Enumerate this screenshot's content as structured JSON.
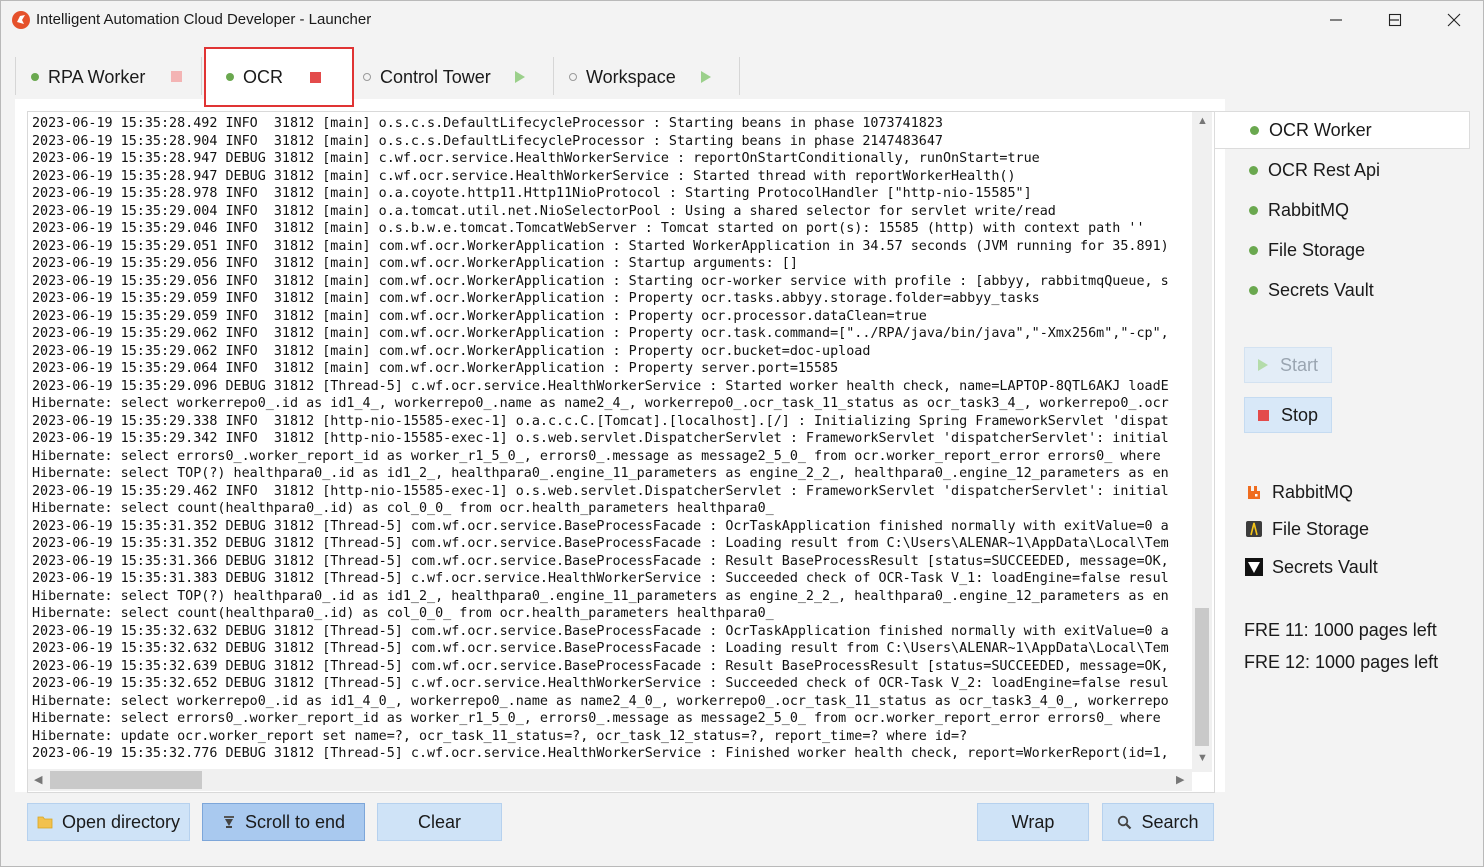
{
  "window": {
    "title": "Intelligent Automation Cloud Developer - Launcher",
    "minimize_icon": "minimize-icon",
    "maximize_icon": "maximize-icon",
    "close_icon": "close-icon"
  },
  "tabs": [
    {
      "label": "RPA Worker",
      "status": "running",
      "control": "stop"
    },
    {
      "label": "OCR",
      "status": "running",
      "control": "stop",
      "selected": true
    },
    {
      "label": "Control Tower",
      "status": "stopped",
      "control": "play"
    },
    {
      "label": "Workspace",
      "status": "stopped",
      "control": "play"
    }
  ],
  "log": {
    "lines": [
      "2023-06-19 15:35:28.492 INFO  31812 [main] o.s.c.s.DefaultLifecycleProcessor : Starting beans in phase 1073741823",
      "2023-06-19 15:35:28.904 INFO  31812 [main] o.s.c.s.DefaultLifecycleProcessor : Starting beans in phase 2147483647",
      "2023-06-19 15:35:28.947 DEBUG 31812 [main] c.wf.ocr.service.HealthWorkerService : reportOnStartConditionally, runOnStart=true",
      "2023-06-19 15:35:28.947 DEBUG 31812 [main] c.wf.ocr.service.HealthWorkerService : Started thread with reportWorkerHealth()",
      "2023-06-19 15:35:28.978 INFO  31812 [main] o.a.coyote.http11.Http11NioProtocol : Starting ProtocolHandler [\"http-nio-15585\"]",
      "2023-06-19 15:35:29.004 INFO  31812 [main] o.a.tomcat.util.net.NioSelectorPool : Using a shared selector for servlet write/read",
      "2023-06-19 15:35:29.046 INFO  31812 [main] o.s.b.w.e.tomcat.TomcatWebServer : Tomcat started on port(s): 15585 (http) with context path ''",
      "2023-06-19 15:35:29.051 INFO  31812 [main] com.wf.ocr.WorkerApplication : Started WorkerApplication in 34.57 seconds (JVM running for 35.891)",
      "2023-06-19 15:35:29.056 INFO  31812 [main] com.wf.ocr.WorkerApplication : Startup arguments: []",
      "2023-06-19 15:35:29.056 INFO  31812 [main] com.wf.ocr.WorkerApplication : Starting ocr-worker service with profile : [abbyy, rabbitmqQueue, s",
      "2023-06-19 15:35:29.059 INFO  31812 [main] com.wf.ocr.WorkerApplication : Property ocr.tasks.abbyy.storage.folder=abbyy_tasks",
      "2023-06-19 15:35:29.059 INFO  31812 [main] com.wf.ocr.WorkerApplication : Property ocr.processor.dataClean=true",
      "2023-06-19 15:35:29.062 INFO  31812 [main] com.wf.ocr.WorkerApplication : Property ocr.task.command=[\"../RPA/java/bin/java\",\"-Xmx256m\",\"-cp\",",
      "2023-06-19 15:35:29.062 INFO  31812 [main] com.wf.ocr.WorkerApplication : Property ocr.bucket=doc-upload",
      "2023-06-19 15:35:29.064 INFO  31812 [main] com.wf.ocr.WorkerApplication : Property server.port=15585",
      "2023-06-19 15:35:29.096 DEBUG 31812 [Thread-5] c.wf.ocr.service.HealthWorkerService : Started worker health check, name=LAPTOP-8QTL6AKJ loadE",
      "Hibernate: select workerrepo0_.id as id1_4_, workerrepo0_.name as name2_4_, workerrepo0_.ocr_task_11_status as ocr_task3_4_, workerrepo0_.ocr",
      "2023-06-19 15:35:29.338 INFO  31812 [http-nio-15585-exec-1] o.a.c.c.C.[Tomcat].[localhost].[/] : Initializing Spring FrameworkServlet 'dispat",
      "2023-06-19 15:35:29.342 INFO  31812 [http-nio-15585-exec-1] o.s.web.servlet.DispatcherServlet : FrameworkServlet 'dispatcherServlet': initial",
      "Hibernate: select errors0_.worker_report_id as worker_r1_5_0_, errors0_.message as message2_5_0_ from ocr.worker_report_error errors0_ where",
      "Hibernate: select TOP(?) healthpara0_.id as id1_2_, healthpara0_.engine_11_parameters as engine_2_2_, healthpara0_.engine_12_parameters as en",
      "2023-06-19 15:35:29.462 INFO  31812 [http-nio-15585-exec-1] o.s.web.servlet.DispatcherServlet : FrameworkServlet 'dispatcherServlet': initial",
      "Hibernate: select count(healthpara0_.id) as col_0_0_ from ocr.health_parameters healthpara0_",
      "2023-06-19 15:35:31.352 DEBUG 31812 [Thread-5] com.wf.ocr.service.BaseProcessFacade : OcrTaskApplication finished normally with exitValue=0 a",
      "2023-06-19 15:35:31.352 DEBUG 31812 [Thread-5] com.wf.ocr.service.BaseProcessFacade : Loading result from C:\\Users\\ALENAR~1\\AppData\\Local\\Tem",
      "2023-06-19 15:35:31.366 DEBUG 31812 [Thread-5] com.wf.ocr.service.BaseProcessFacade : Result BaseProcessResult [status=SUCCEEDED, message=OK,",
      "2023-06-19 15:35:31.383 DEBUG 31812 [Thread-5] c.wf.ocr.service.HealthWorkerService : Succeeded check of OCR-Task V_1: loadEngine=false resul",
      "Hibernate: select TOP(?) healthpara0_.id as id1_2_, healthpara0_.engine_11_parameters as engine_2_2_, healthpara0_.engine_12_parameters as en",
      "Hibernate: select count(healthpara0_.id) as col_0_0_ from ocr.health_parameters healthpara0_",
      "2023-06-19 15:35:32.632 DEBUG 31812 [Thread-5] com.wf.ocr.service.BaseProcessFacade : OcrTaskApplication finished normally with exitValue=0 a",
      "2023-06-19 15:35:32.632 DEBUG 31812 [Thread-5] com.wf.ocr.service.BaseProcessFacade : Loading result from C:\\Users\\ALENAR~1\\AppData\\Local\\Tem",
      "2023-06-19 15:35:32.639 DEBUG 31812 [Thread-5] com.wf.ocr.service.BaseProcessFacade : Result BaseProcessResult [status=SUCCEEDED, message=OK,",
      "2023-06-19 15:35:32.652 DEBUG 31812 [Thread-5] c.wf.ocr.service.HealthWorkerService : Succeeded check of OCR-Task V_2: loadEngine=false resul",
      "Hibernate: select workerrepo0_.id as id1_4_0_, workerrepo0_.name as name2_4_0_, workerrepo0_.ocr_task_11_status as ocr_task3_4_0_, workerrepo",
      "Hibernate: select errors0_.worker_report_id as worker_r1_5_0_, errors0_.message as message2_5_0_ from ocr.worker_report_error errors0_ where",
      "Hibernate: update ocr.worker_report set name=?, ocr_task_11_status=?, ocr_task_12_status=?, report_time=? where id=?",
      "2023-06-19 15:35:32.776 DEBUG 31812 [Thread-5] c.wf.ocr.service.HealthWorkerService : Finished worker health check, report=WorkerReport(id=1,"
    ]
  },
  "toolbar": {
    "open_directory": "Open directory",
    "scroll_to_end": "Scroll to end",
    "clear": "Clear",
    "wrap": "Wrap",
    "search": "Search"
  },
  "services": [
    {
      "label": "OCR Worker",
      "status": "running",
      "selected": true
    },
    {
      "label": "OCR Rest Api",
      "status": "running"
    },
    {
      "label": "RabbitMQ",
      "status": "running"
    },
    {
      "label": "File Storage",
      "status": "running"
    },
    {
      "label": "Secrets Vault",
      "status": "running"
    }
  ],
  "controls": {
    "start": "Start",
    "stop": "Stop"
  },
  "links": [
    {
      "label": "RabbitMQ",
      "icon": "rabbitmq-icon"
    },
    {
      "label": "File Storage",
      "icon": "file-storage-icon"
    },
    {
      "label": "Secrets Vault",
      "icon": "vault-icon"
    }
  ],
  "quotas": [
    "FRE 11: 1000 pages left",
    "FRE 12: 1000 pages left"
  ],
  "colors": {
    "running": "#6aa84f",
    "stop_red": "#e34b4b",
    "play_green": "#9bd08b",
    "button_blue": "#cfe3f7",
    "highlight_red": "#e03434"
  }
}
